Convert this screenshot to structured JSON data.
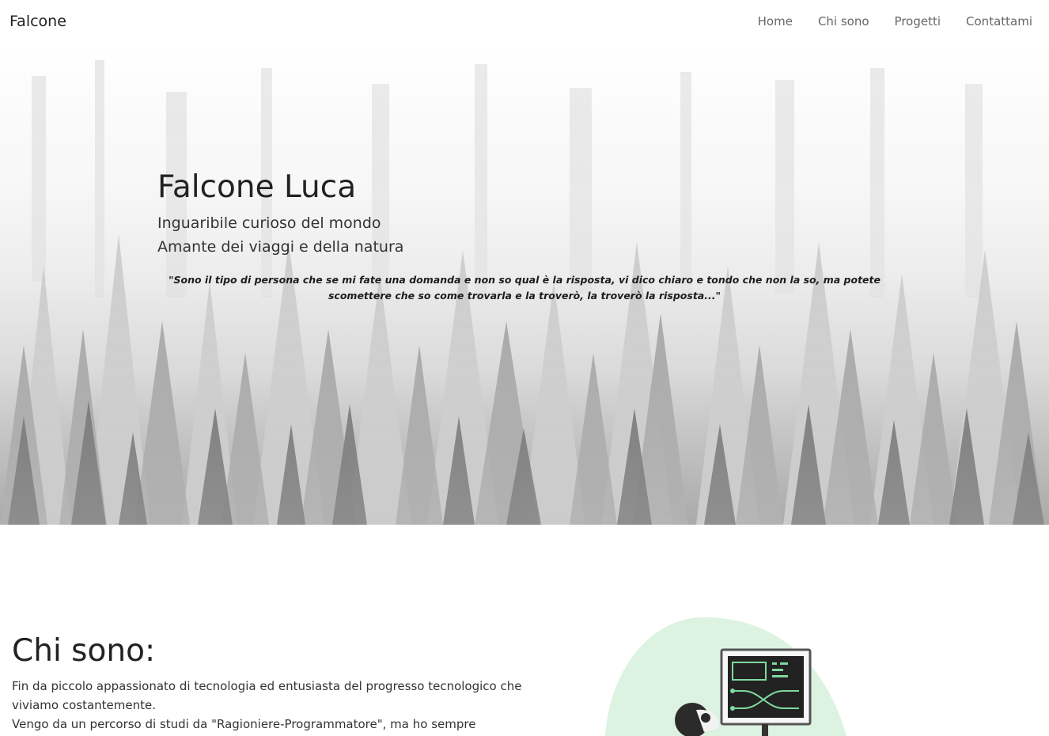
{
  "navbar": {
    "brand": "Falcone",
    "links": [
      "Home",
      "Chi sono",
      "Progetti",
      "Contattami"
    ]
  },
  "hero": {
    "title": "Falcone Luca",
    "subtitle_line1": "Inguaribile curioso del mondo",
    "subtitle_line2": "Amante dei viaggi e della natura",
    "quote": "\"Sono il tipo di persona che se mi fate una domanda e non so qual è la risposta, vi dico chiaro e tondo che non la so, ma potete scomettere che so come trovarla e la troverò, la troverò la risposta...\""
  },
  "about": {
    "title": "Chi sono:",
    "paragraph1": "Fin da piccolo appassionato di tecnologia ed entusiasta del progresso tecnologico che viviamo costantemente.",
    "paragraph2": "Vengo da un percorso di studi da \"Ragioniere-Programmatore\", ma ho sempre"
  },
  "colors": {
    "blob": "#dcf3e1",
    "monitor": "#222222",
    "monitor_accent": "#7fd9a0"
  },
  "icons": {
    "illustration": "developer-illustration"
  }
}
